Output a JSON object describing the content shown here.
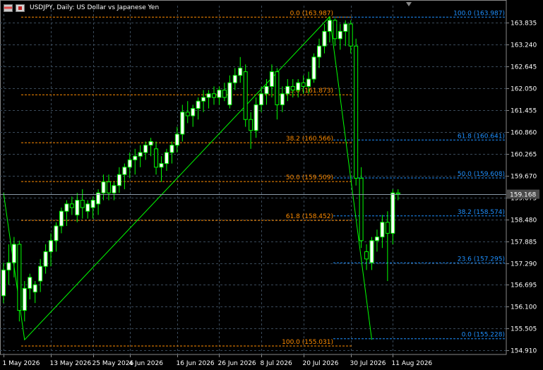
{
  "header": {
    "title": "USDJPY, Daily:  US Dollar vs Japanese Yen",
    "icon_left": "chart-window-icon",
    "icon_right": "calendar-icon"
  },
  "colors": {
    "background": "#000000",
    "grid": "#3a4a5a",
    "axis_text": "#ffffff",
    "bull_candle": "#ffffff",
    "bear_candle": "#000000",
    "candle_wick": "#00ff00",
    "fibo_line": "#ff8c00",
    "fibo_text": "#ff8c00",
    "fibo2_line": "#1e90ff",
    "fibo2_text": "#1e90ff",
    "trend_line": "#00ff00",
    "current_price_bg": "#4a4a4a"
  },
  "chart_data": {
    "type": "candlestick",
    "symbol": "USDJPY",
    "timeframe": "Daily",
    "ylim": [
      154.8,
      164.3
    ],
    "y_ticks": [
      "163.835",
      "163.240",
      "162.645",
      "162.050",
      "161.455",
      "160.860",
      "160.265",
      "159.670",
      "159.075",
      "158.480",
      "157.885",
      "157.290",
      "156.695",
      "156.100",
      "155.505",
      "154.910"
    ],
    "x_ticks": [
      "1 May 2026",
      "13 May 2026",
      "25 May 2026",
      "4 Jun 2026",
      "16 Jun 2026",
      "26 Jun 2026",
      "8 Jul 2026",
      "20 Jul 2026",
      "30 Jul 2026",
      "11 Aug 2026"
    ],
    "current_price": "159.168",
    "candles": [
      {
        "o": 156.4,
        "h": 157.3,
        "l": 156.2,
        "c": 157.1
      },
      {
        "o": 157.1,
        "h": 157.8,
        "l": 156.7,
        "c": 157.3
      },
      {
        "o": 157.3,
        "h": 158.0,
        "l": 156.9,
        "c": 157.8
      },
      {
        "o": 157.8,
        "h": 157.9,
        "l": 155.7,
        "c": 156.0
      },
      {
        "o": 156.0,
        "h": 156.8,
        "l": 155.7,
        "c": 156.6
      },
      {
        "o": 156.6,
        "h": 157.0,
        "l": 156.3,
        "c": 156.9
      },
      {
        "o": 156.5,
        "h": 156.8,
        "l": 156.2,
        "c": 156.7
      },
      {
        "o": 156.8,
        "h": 157.4,
        "l": 156.5,
        "c": 157.2
      },
      {
        "o": 157.2,
        "h": 157.8,
        "l": 157.0,
        "c": 157.6
      },
      {
        "o": 157.6,
        "h": 158.1,
        "l": 157.2,
        "c": 157.9
      },
      {
        "o": 157.9,
        "h": 158.4,
        "l": 157.6,
        "c": 158.3
      },
      {
        "o": 158.3,
        "h": 158.8,
        "l": 158.1,
        "c": 158.7
      },
      {
        "o": 158.7,
        "h": 159.0,
        "l": 158.3,
        "c": 158.9
      },
      {
        "o": 158.9,
        "h": 159.1,
        "l": 158.6,
        "c": 158.8
      },
      {
        "o": 158.6,
        "h": 159.2,
        "l": 158.4,
        "c": 159.0
      },
      {
        "o": 159.0,
        "h": 159.3,
        "l": 158.5,
        "c": 158.8
      },
      {
        "o": 158.7,
        "h": 159.0,
        "l": 158.5,
        "c": 158.9
      },
      {
        "o": 158.8,
        "h": 159.1,
        "l": 158.5,
        "c": 159.0
      },
      {
        "o": 158.9,
        "h": 159.3,
        "l": 158.6,
        "c": 159.2
      },
      {
        "o": 159.2,
        "h": 159.7,
        "l": 159.0,
        "c": 159.5
      },
      {
        "o": 159.5,
        "h": 159.7,
        "l": 159.0,
        "c": 159.2
      },
      {
        "o": 159.2,
        "h": 159.5,
        "l": 159.0,
        "c": 159.4
      },
      {
        "o": 159.4,
        "h": 159.9,
        "l": 159.2,
        "c": 159.7
      },
      {
        "o": 159.7,
        "h": 160.0,
        "l": 159.3,
        "c": 159.9
      },
      {
        "o": 159.9,
        "h": 160.3,
        "l": 159.6,
        "c": 160.1
      },
      {
        "o": 160.1,
        "h": 160.4,
        "l": 159.7,
        "c": 160.2
      },
      {
        "o": 160.2,
        "h": 160.5,
        "l": 159.9,
        "c": 160.3
      },
      {
        "o": 160.3,
        "h": 160.6,
        "l": 160.1,
        "c": 160.5
      },
      {
        "o": 160.5,
        "h": 160.7,
        "l": 160.2,
        "c": 160.6
      },
      {
        "o": 160.4,
        "h": 160.6,
        "l": 159.7,
        "c": 159.9
      },
      {
        "o": 159.9,
        "h": 160.2,
        "l": 159.5,
        "c": 160.0
      },
      {
        "o": 160.0,
        "h": 160.4,
        "l": 159.8,
        "c": 160.3
      },
      {
        "o": 160.3,
        "h": 160.6,
        "l": 160.0,
        "c": 160.5
      },
      {
        "o": 160.5,
        "h": 161.0,
        "l": 160.3,
        "c": 160.8
      },
      {
        "o": 160.8,
        "h": 161.6,
        "l": 160.6,
        "c": 161.4
      },
      {
        "o": 161.4,
        "h": 161.7,
        "l": 161.1,
        "c": 161.3
      },
      {
        "o": 161.3,
        "h": 161.6,
        "l": 161.0,
        "c": 161.5
      },
      {
        "o": 161.5,
        "h": 161.8,
        "l": 161.2,
        "c": 161.7
      },
      {
        "o": 161.7,
        "h": 162.0,
        "l": 161.4,
        "c": 161.8
      },
      {
        "o": 161.8,
        "h": 162.0,
        "l": 161.5,
        "c": 161.9
      },
      {
        "o": 161.9,
        "h": 162.1,
        "l": 161.6,
        "c": 161.8
      },
      {
        "o": 161.8,
        "h": 162.1,
        "l": 161.6,
        "c": 162.0
      },
      {
        "o": 162.0,
        "h": 162.2,
        "l": 161.7,
        "c": 161.8
      },
      {
        "o": 161.6,
        "h": 162.4,
        "l": 161.5,
        "c": 162.2
      },
      {
        "o": 162.2,
        "h": 162.6,
        "l": 162.0,
        "c": 162.4
      },
      {
        "o": 162.4,
        "h": 162.9,
        "l": 162.2,
        "c": 162.6
      },
      {
        "o": 162.5,
        "h": 162.7,
        "l": 161.0,
        "c": 161.2
      },
      {
        "o": 161.2,
        "h": 161.4,
        "l": 160.4,
        "c": 160.9
      },
      {
        "o": 160.9,
        "h": 161.8,
        "l": 160.7,
        "c": 161.6
      },
      {
        "o": 161.6,
        "h": 162.1,
        "l": 161.4,
        "c": 161.9
      },
      {
        "o": 161.9,
        "h": 162.3,
        "l": 161.6,
        "c": 162.1
      },
      {
        "o": 162.1,
        "h": 162.7,
        "l": 161.8,
        "c": 162.5
      },
      {
        "o": 162.5,
        "h": 162.6,
        "l": 161.2,
        "c": 161.6
      },
      {
        "o": 161.6,
        "h": 162.1,
        "l": 161.4,
        "c": 161.9
      },
      {
        "o": 161.9,
        "h": 162.3,
        "l": 161.7,
        "c": 162.1
      },
      {
        "o": 162.1,
        "h": 162.3,
        "l": 161.8,
        "c": 162.0
      },
      {
        "o": 162.0,
        "h": 162.3,
        "l": 161.8,
        "c": 162.2
      },
      {
        "o": 162.2,
        "h": 162.4,
        "l": 161.9,
        "c": 162.1
      },
      {
        "o": 162.1,
        "h": 162.5,
        "l": 161.9,
        "c": 162.3
      },
      {
        "o": 162.3,
        "h": 163.0,
        "l": 162.2,
        "c": 162.9
      },
      {
        "o": 162.9,
        "h": 163.4,
        "l": 162.6,
        "c": 163.2
      },
      {
        "o": 163.2,
        "h": 163.8,
        "l": 163.0,
        "c": 163.6
      },
      {
        "o": 163.6,
        "h": 163.99,
        "l": 163.3,
        "c": 163.9
      },
      {
        "o": 163.9,
        "h": 163.95,
        "l": 163.2,
        "c": 163.4
      },
      {
        "o": 163.4,
        "h": 163.8,
        "l": 163.1,
        "c": 163.6
      },
      {
        "o": 163.6,
        "h": 163.9,
        "l": 163.2,
        "c": 163.8
      },
      {
        "o": 163.8,
        "h": 163.9,
        "l": 163.0,
        "c": 163.2
      },
      {
        "o": 163.2,
        "h": 163.4,
        "l": 159.4,
        "c": 159.6
      },
      {
        "o": 159.6,
        "h": 159.9,
        "l": 157.7,
        "c": 157.9
      },
      {
        "o": 157.6,
        "h": 157.8,
        "l": 157.1,
        "c": 157.4
      },
      {
        "o": 157.3,
        "h": 158.0,
        "l": 157.1,
        "c": 157.9
      },
      {
        "o": 157.9,
        "h": 158.2,
        "l": 157.6,
        "c": 158.0
      },
      {
        "o": 158.0,
        "h": 158.6,
        "l": 157.7,
        "c": 158.4
      },
      {
        "o": 158.4,
        "h": 158.7,
        "l": 156.8,
        "c": 158.1
      },
      {
        "o": 158.1,
        "h": 159.3,
        "l": 157.8,
        "c": 159.2
      },
      {
        "o": 159.2,
        "h": 159.3,
        "l": 159.0,
        "c": 159.17
      }
    ],
    "trend_line": {
      "points": [
        [
          0,
          159.2
        ],
        [
          4,
          155.2
        ],
        [
          62,
          164.0
        ],
        [
          70,
          155.2
        ]
      ]
    },
    "fibo_retracement": {
      "levels": [
        {
          "label": "0.0 (163.987)",
          "value": 163.987
        },
        {
          "label": "23.6 (161.873)",
          "value": 161.873
        },
        {
          "label": "38.2 (160.566)",
          "value": 160.566
        },
        {
          "label": "50.0 (159.509)",
          "value": 159.509
        },
        {
          "label": "61.8 (158.452)",
          "value": 158.452
        },
        {
          "label": "100.0 (155.031)",
          "value": 155.031
        }
      ]
    },
    "fibo_retracement_2": {
      "levels": [
        {
          "label": "100.0 (163.987)",
          "value": 163.987
        },
        {
          "label": "61.8 (160.641)",
          "value": 160.641
        },
        {
          "label": "50.0 (159.608)",
          "value": 159.608
        },
        {
          "label": "38.2 (158.574)",
          "value": 158.574
        },
        {
          "label": "23.6 (157.295)",
          "value": 157.295
        },
        {
          "label": "0.0 (155.228)",
          "value": 155.228
        }
      ]
    }
  }
}
